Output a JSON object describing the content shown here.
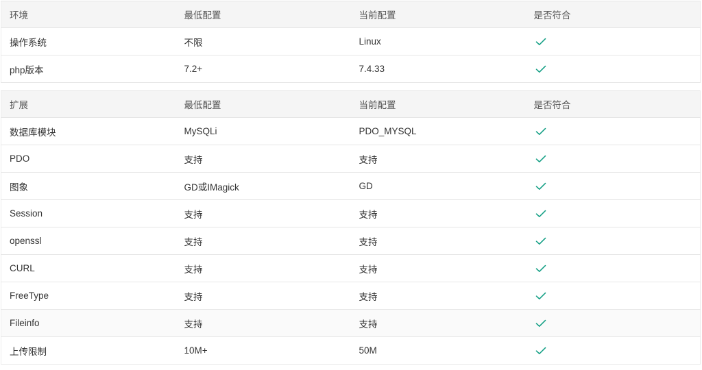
{
  "environment_table": {
    "headers": [
      "环境",
      "最低配置",
      "当前配置",
      "是否符合"
    ],
    "rows": [
      {
        "name": "操作系统",
        "minimum": "不限",
        "current": "Linux",
        "ok": true
      },
      {
        "name": "php版本",
        "minimum": "7.2+",
        "current": "7.4.33",
        "ok": true
      }
    ]
  },
  "extension_table": {
    "headers": [
      "扩展",
      "最低配置",
      "当前配置",
      "是否符合"
    ],
    "rows": [
      {
        "name": "数据库模块",
        "minimum": "MySQLi",
        "current": "PDO_MYSQL",
        "ok": true
      },
      {
        "name": "PDO",
        "minimum": "支持",
        "current": "支持",
        "ok": true
      },
      {
        "name": "图象",
        "minimum": "GD或IMagick",
        "current": "GD",
        "ok": true
      },
      {
        "name": "Session",
        "minimum": "支持",
        "current": "支持",
        "ok": true
      },
      {
        "name": "openssl",
        "minimum": "支持",
        "current": "支持",
        "ok": true
      },
      {
        "name": "CURL",
        "minimum": "支持",
        "current": "支持",
        "ok": true
      },
      {
        "name": "FreeType",
        "minimum": "支持",
        "current": "支持",
        "ok": true
      },
      {
        "name": "Fileinfo",
        "minimum": "支持",
        "current": "支持",
        "ok": true
      },
      {
        "name": "上传限制",
        "minimum": "10M+",
        "current": "50M",
        "ok": true
      }
    ]
  },
  "icons": {
    "pass": "check-icon"
  },
  "colors": {
    "check": "#16a086",
    "header_bg": "#f5f5f5",
    "border": "#e6e6e6"
  }
}
